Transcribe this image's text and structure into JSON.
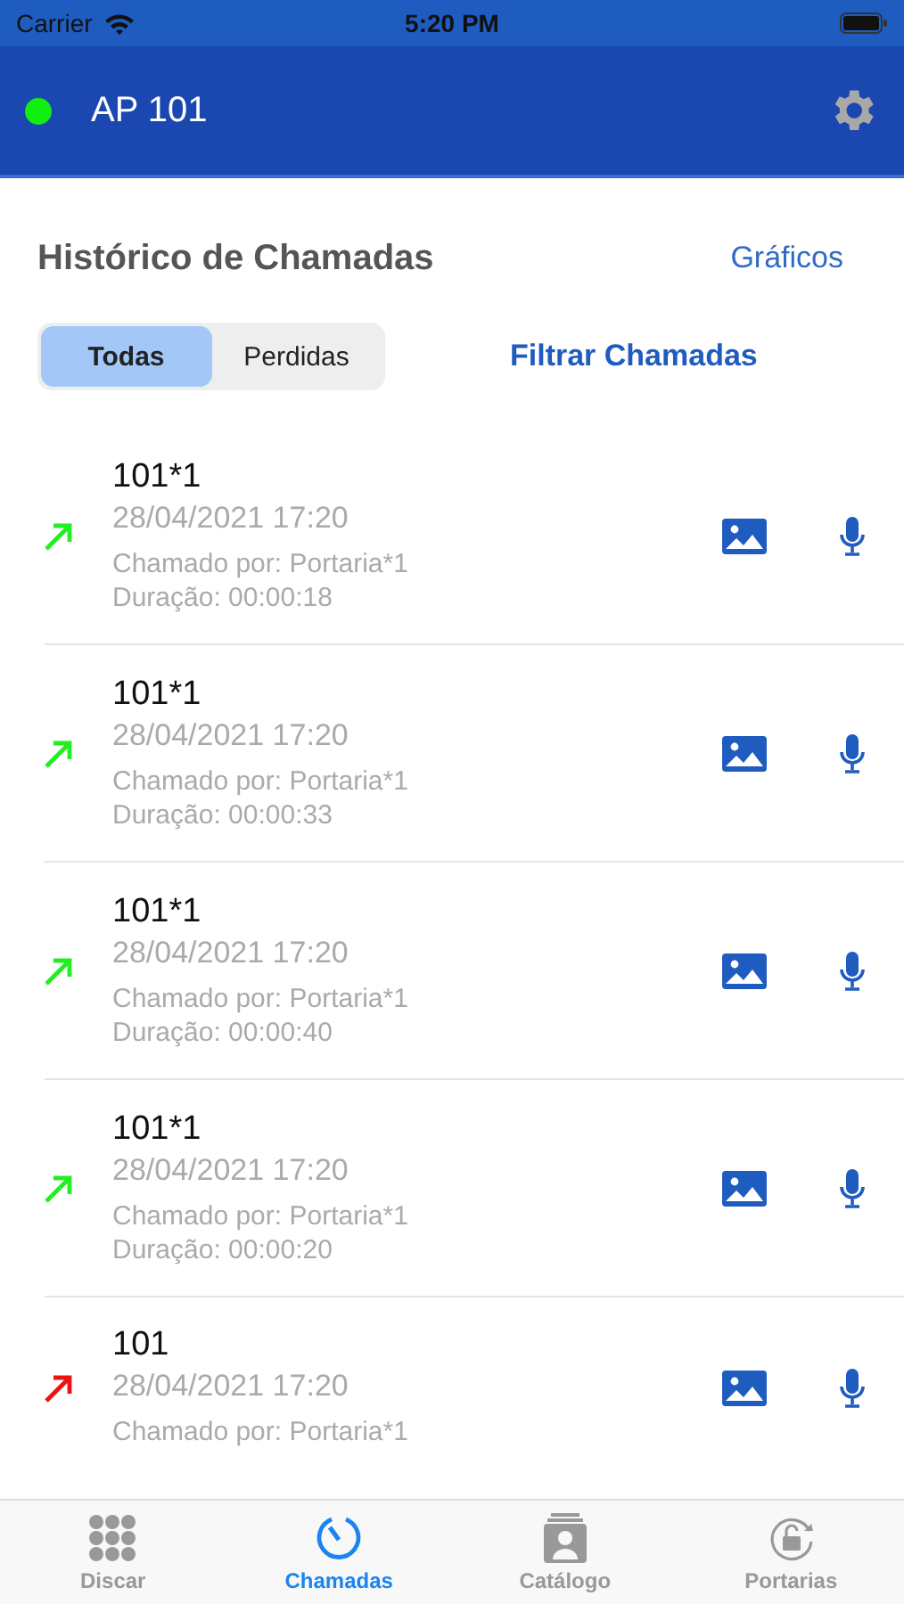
{
  "status_bar": {
    "carrier": "Carrier",
    "time": "5:20 PM"
  },
  "header": {
    "title": "AP 101",
    "connected": true
  },
  "section": {
    "title": "Histórico de Chamadas",
    "link": "Gráficos"
  },
  "filter": {
    "segments": [
      {
        "label": "Todas",
        "selected": true
      },
      {
        "label": "Perdidas",
        "selected": false
      }
    ],
    "action": "Filtrar Chamadas"
  },
  "calls": [
    {
      "name": "101*1",
      "datetime": "28/04/2021 17:20",
      "caller": "Chamado por: Portaria*1",
      "duration": "Duração: 00:00:18",
      "color": "#22ee22"
    },
    {
      "name": "101*1",
      "datetime": "28/04/2021 17:20",
      "caller": "Chamado por: Portaria*1",
      "duration": "Duração: 00:00:33",
      "color": "#22ee22"
    },
    {
      "name": "101*1",
      "datetime": "28/04/2021 17:20",
      "caller": "Chamado por: Portaria*1",
      "duration": "Duração: 00:00:40",
      "color": "#22ee22"
    },
    {
      "name": "101*1",
      "datetime": "28/04/2021 17:20",
      "caller": "Chamado por: Portaria*1",
      "duration": "Duração: 00:00:20",
      "color": "#22ee22"
    },
    {
      "name": "101",
      "datetime": "28/04/2021 17:20",
      "caller": "Chamado por: Portaria*1",
      "color": "#ee1111"
    }
  ],
  "tabs": [
    {
      "label": "Discar",
      "kind": "dial",
      "selected": false
    },
    {
      "label": "Chamadas",
      "kind": "clock",
      "selected": true
    },
    {
      "label": "Catálogo",
      "kind": "contacts",
      "selected": false
    },
    {
      "label": "Portarias",
      "kind": "lock",
      "selected": false
    }
  ]
}
